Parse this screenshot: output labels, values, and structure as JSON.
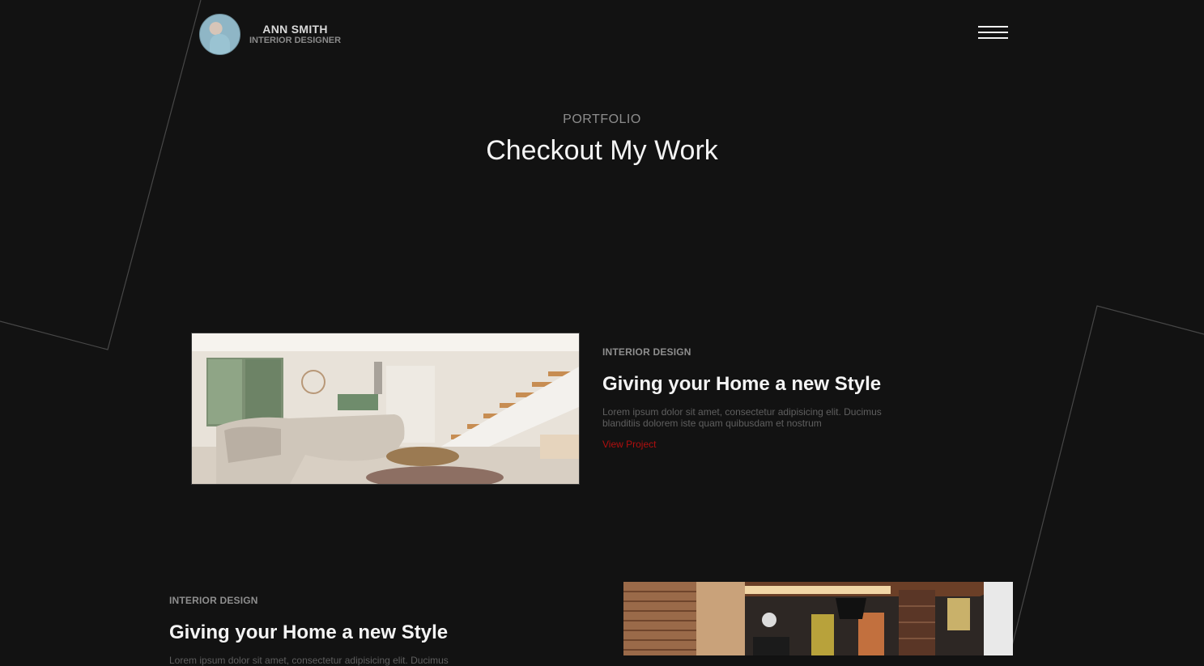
{
  "brand": {
    "name": "ANN SMITH",
    "role": "INTERIOR DESIGNER"
  },
  "menu": {
    "icon": "hamburger-menu-icon"
  },
  "section": {
    "eyebrow": "PORTFOLIO",
    "title": "Checkout My Work"
  },
  "projects": [
    {
      "category": "INTERIOR DESIGN",
      "title": "Giving your Home a new Style",
      "description": "Lorem ipsum dolor sit amet, consectetur adipisicing elit. Ducimus blanditiis dolorem iste quam quibusdam et nostrum",
      "link": "View Project",
      "image": "living-room-with-staircase-photo"
    },
    {
      "category": "INTERIOR DESIGN",
      "title": "Giving your Home a new Style",
      "description": "Lorem ipsum dolor sit amet, consectetur adipisicing elit. Ducimus",
      "image": "dark-living-room-photo"
    }
  ],
  "colors": {
    "background": "#121212",
    "accent": "#b00f0f",
    "text": "#f4f4f4",
    "muted": "#8e8e8e"
  }
}
